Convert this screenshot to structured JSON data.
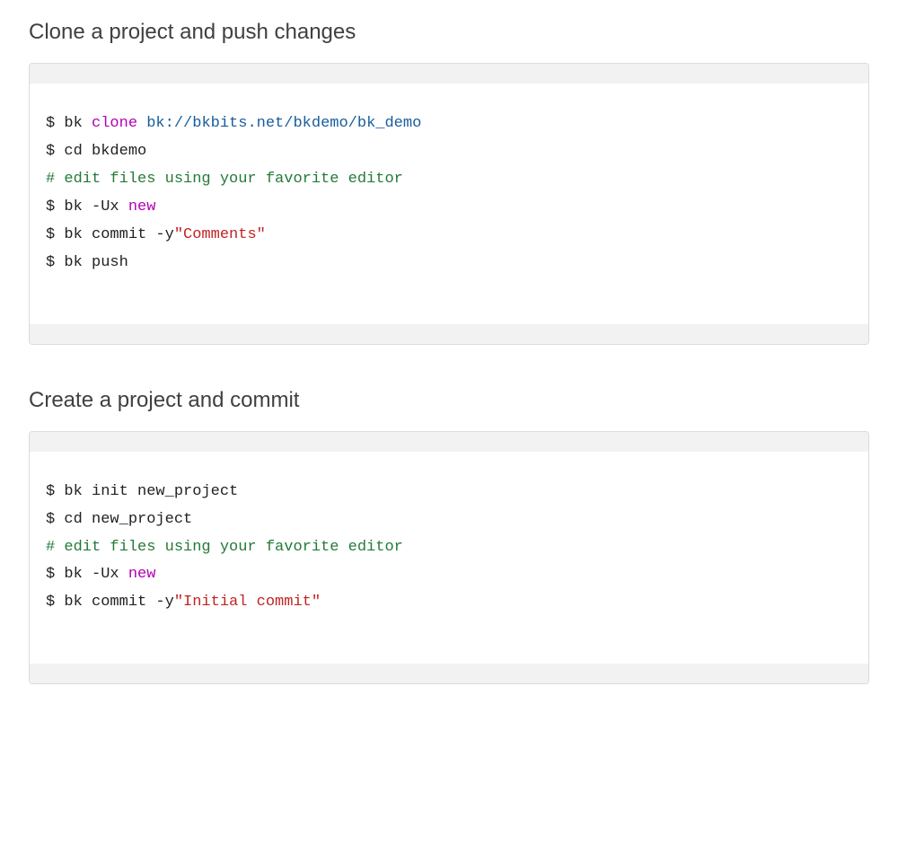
{
  "sections": [
    {
      "title": "Clone a project and push changes",
      "lines": [
        [
          {
            "t": "$ ",
            "c": "tok-prompt"
          },
          {
            "t": "bk ",
            "c": "tok-cmd"
          },
          {
            "t": "clone ",
            "c": "tok-sub"
          },
          {
            "t": "bk://bkbits.net/bkdemo/bk_demo",
            "c": "tok-arg"
          }
        ],
        [
          {
            "t": "$ ",
            "c": "tok-prompt"
          },
          {
            "t": "cd ",
            "c": "tok-cmd"
          },
          {
            "t": "bkdemo",
            "c": "tok-cmd"
          }
        ],
        [
          {
            "t": "# edit files using your favorite editor",
            "c": "tok-comment"
          }
        ],
        [
          {
            "t": "$ ",
            "c": "tok-prompt"
          },
          {
            "t": "bk -Ux ",
            "c": "tok-cmd"
          },
          {
            "t": "new",
            "c": "tok-sub"
          }
        ],
        [
          {
            "t": "$ ",
            "c": "tok-prompt"
          },
          {
            "t": "bk commit -y",
            "c": "tok-cmd"
          },
          {
            "t": "\"Comments\"",
            "c": "tok-str"
          }
        ],
        [
          {
            "t": "$ ",
            "c": "tok-prompt"
          },
          {
            "t": "bk push",
            "c": "tok-cmd"
          }
        ]
      ]
    },
    {
      "title": "Create a project and commit",
      "lines": [
        [
          {
            "t": "$ ",
            "c": "tok-prompt"
          },
          {
            "t": "bk init new_project",
            "c": "tok-cmd"
          }
        ],
        [
          {
            "t": "$ ",
            "c": "tok-prompt"
          },
          {
            "t": "cd ",
            "c": "tok-cmd"
          },
          {
            "t": "new_project",
            "c": "tok-cmd"
          }
        ],
        [
          {
            "t": "# edit files using your favorite editor",
            "c": "tok-comment"
          }
        ],
        [
          {
            "t": "$ ",
            "c": "tok-prompt"
          },
          {
            "t": "bk -Ux ",
            "c": "tok-cmd"
          },
          {
            "t": "new",
            "c": "tok-sub"
          }
        ],
        [
          {
            "t": "$ ",
            "c": "tok-prompt"
          },
          {
            "t": "bk commit -y",
            "c": "tok-cmd"
          },
          {
            "t": "\"Initial commit\"",
            "c": "tok-str"
          }
        ]
      ]
    }
  ]
}
